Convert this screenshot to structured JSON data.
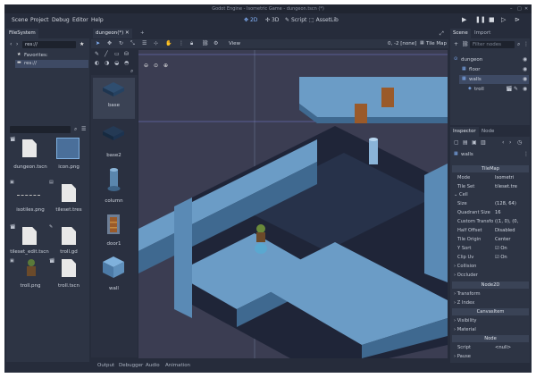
{
  "window": {
    "title": "Godot Engine - Isometric Game - dungeon.tscn (*)"
  },
  "menu": {
    "items": [
      "Scene",
      "Project",
      "Debug",
      "Editor",
      "Help"
    ]
  },
  "workspaces": {
    "two_d": "2D",
    "three_d": "3D",
    "script": "Script",
    "assetlib": "AssetLib"
  },
  "filesystem": {
    "tab_label": "FileSystem",
    "path": "res://",
    "favorites_label": "Favorites:",
    "root_label": "res://",
    "files": [
      {
        "name": "dungeon.tscn"
      },
      {
        "name": "icon.png"
      },
      {
        "name": "isotiles.png"
      },
      {
        "name": "tileset.tres"
      },
      {
        "name": "tileset_edit.tscn"
      },
      {
        "name": "troll.gd"
      },
      {
        "name": "troll.png"
      },
      {
        "name": "troll.tscn"
      }
    ]
  },
  "editor": {
    "scene_tab": "dungeon(*)",
    "view_menu": "View",
    "coords": "0, -2 [none]",
    "tilemap_label": "Tile Map"
  },
  "palette": {
    "tiles": [
      {
        "label": "base"
      },
      {
        "label": "base2"
      },
      {
        "label": "column"
      },
      {
        "label": "door1"
      },
      {
        "label": "wall"
      }
    ]
  },
  "bottom_tabs": [
    "Output",
    "Debugger",
    "Audio",
    "Animation"
  ],
  "scene_dock": {
    "tabs": [
      "Scene",
      "Import"
    ],
    "filter_placeholder": "Filter nodes",
    "nodes": [
      "dungeon",
      "floor",
      "walls",
      "troll"
    ]
  },
  "inspector": {
    "tabs": [
      "Inspector",
      "Node"
    ],
    "object_name": "walls",
    "class_tilemap": "TileMap",
    "mode": {
      "label": "Mode",
      "value": "Isometri"
    },
    "tileset": {
      "label": "Tile Set",
      "value": "tileset.tre"
    },
    "cell_section": "Cell",
    "size": {
      "label": "Size",
      "value": "(128, 64)"
    },
    "quadrant": {
      "label": "Quadrant Size",
      "value": "16"
    },
    "custom_transform": {
      "label": "Custom Transfo",
      "value": "((1, 0), (0,"
    },
    "half_offset": {
      "label": "Half Offset",
      "value": "Disabled"
    },
    "tile_origin": {
      "label": "Tile Origin",
      "value": "Center"
    },
    "y_sort": {
      "label": "Y Sort",
      "value": "On"
    },
    "clip_uv": {
      "label": "Clip Uv",
      "value": "On"
    },
    "collision": "Collision",
    "occluder": "Occluder",
    "class_node2d": "Node2D",
    "transform": "Transform",
    "z_index": "Z Index",
    "class_canvasitem": "CanvasItem",
    "visibility": "Visibility",
    "material": "Material",
    "class_node": "Node",
    "script": {
      "label": "Script",
      "value": "<null>"
    },
    "pause": "Pause"
  }
}
